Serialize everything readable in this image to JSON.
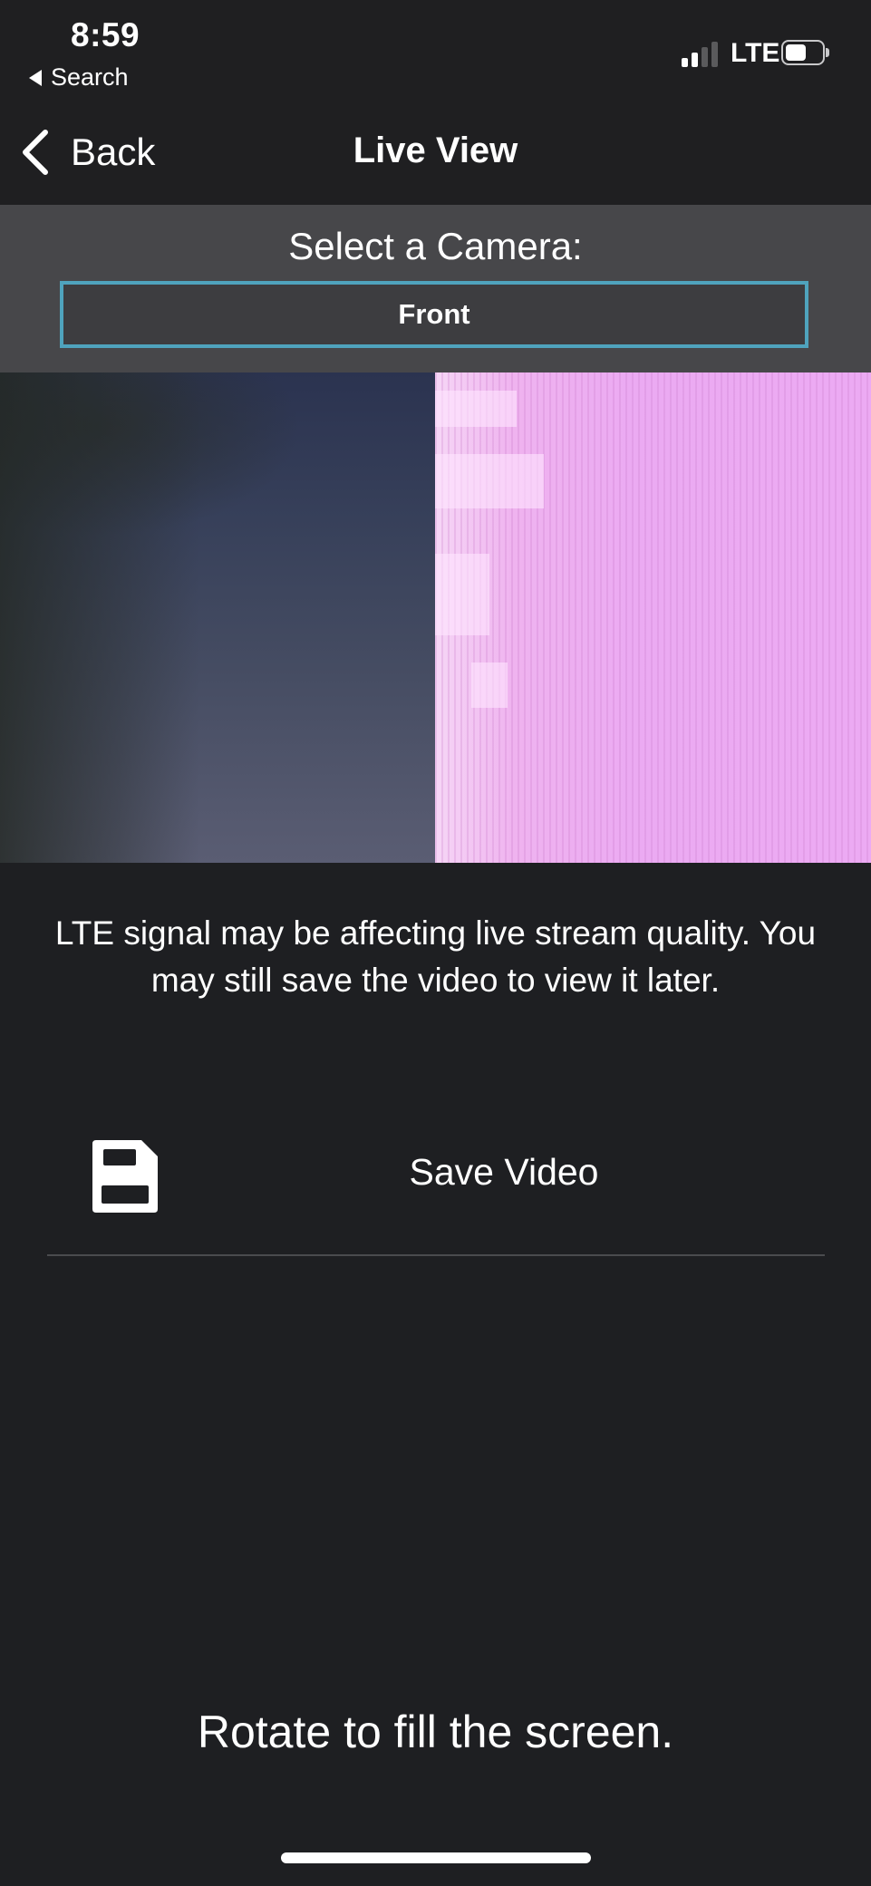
{
  "status_bar": {
    "time": "8:59",
    "back_app": "Search",
    "network": "LTE",
    "signal_bars_filled": 2,
    "signal_bars_total": 4,
    "battery_level": 0.5
  },
  "nav": {
    "back_label": "Back",
    "title": "Live View"
  },
  "camera": {
    "heading": "Select a Camera:",
    "selected": "Front"
  },
  "warning": "LTE signal may be affecting live stream quality. You may still save the video to view it later.",
  "save": {
    "label": "Save Video",
    "icon": "floppy-disk-icon"
  },
  "rotate_hint": "Rotate to fill the screen.",
  "colors": {
    "background": "#1e1f22",
    "panel": "#47474a",
    "select_border": "#4fa3bd",
    "video_right": "#ecaaf3"
  }
}
